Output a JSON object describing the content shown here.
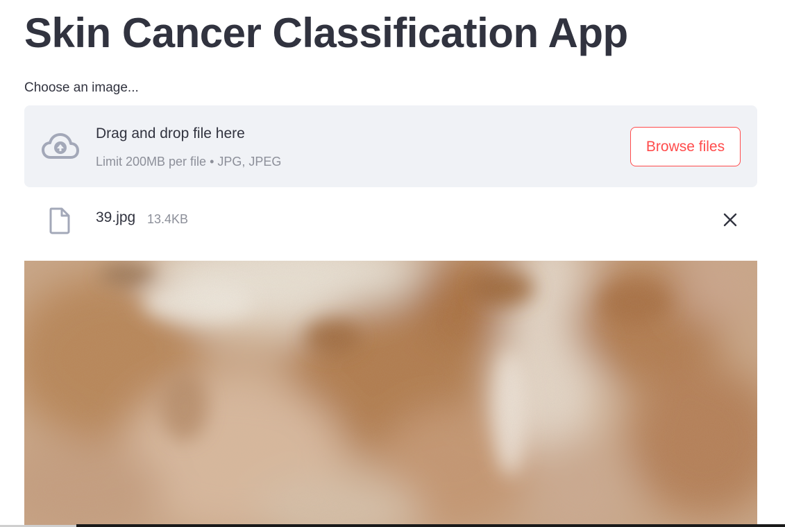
{
  "app": {
    "title": "Skin Cancer Classification App"
  },
  "uploader": {
    "label": "Choose an image...",
    "drop_text": "Drag and drop file here",
    "limit_text": "Limit 200MB per file • JPG, JPEG",
    "browse_label": "Browse files",
    "icon": "cloud-upload-icon"
  },
  "uploaded_file": {
    "name": "39.jpg",
    "size": "13.4KB",
    "icon": "file-icon",
    "remove_icon": "close-icon"
  },
  "colors": {
    "accent": "#ff4b4b",
    "text": "#31333f",
    "muted": "#8c8f99",
    "dropzone_bg": "#f0f2f6",
    "icon": "#a3a8b8"
  }
}
